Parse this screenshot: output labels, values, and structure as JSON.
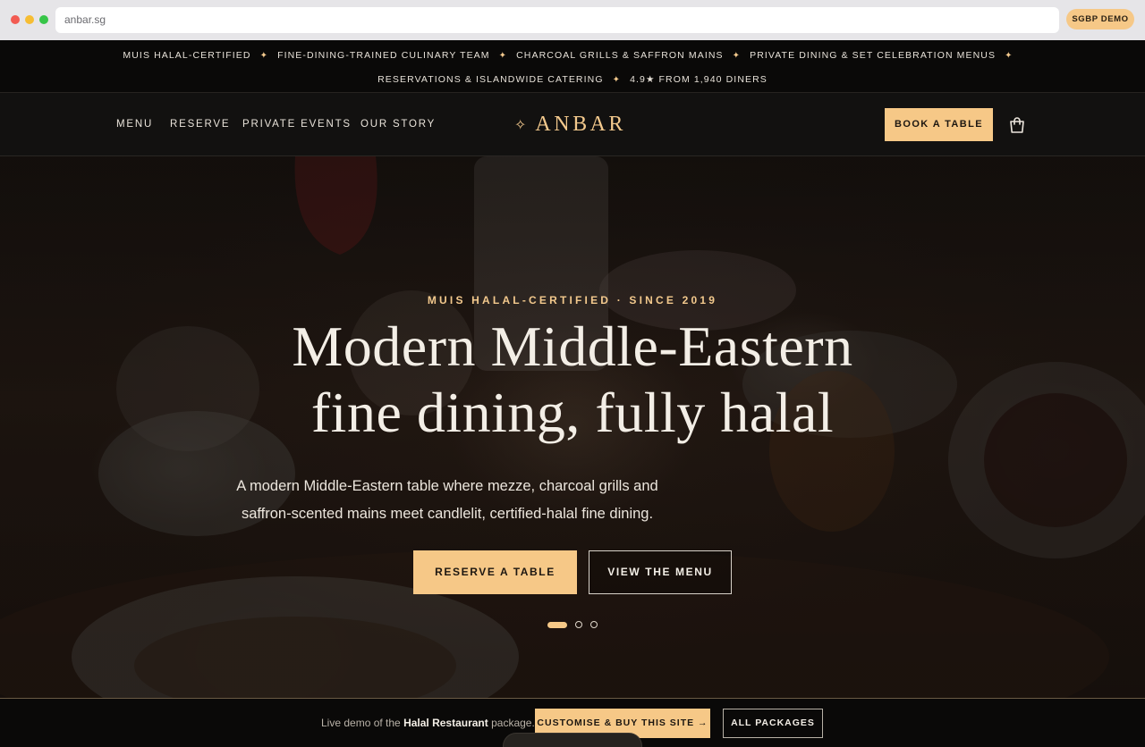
{
  "browser": {
    "url": "anbar.sg",
    "badge": "SGBP DEMO"
  },
  "trust_strip": {
    "row1": [
      "MUIS HALAL-CERTIFIED",
      "FINE-DINING-TRAINED CULINARY TEAM",
      "CHARCOAL GRILLS & SAFFRON MAINS",
      "PRIVATE DINING & SET CELEBRATION MENUS"
    ],
    "row2": [
      "RESERVATIONS & ISLANDWIDE CATERING",
      "4.9★ FROM 1,940 DINERS"
    ],
    "separator": "✦"
  },
  "nav": {
    "links": [
      "MENU",
      "RESERVE",
      "PRIVATE EVENTS",
      "OUR STORY"
    ],
    "logo_mark": "✧",
    "logo_text": "ANBAR",
    "cta": "BOOK A TABLE",
    "cart_icon": "shopping-bag-icon"
  },
  "hero": {
    "eyebrow": "MUIS HALAL-CERTIFIED · SINCE 2019",
    "title_line1": "Modern Middle-Eastern",
    "title_line2": "fine dining, fully halal",
    "subtitle": "A modern Middle-Eastern table where mezze, charcoal grills and saffron-scented mains meet candlelit, certified-halal fine dining.",
    "primary_cta": "RESERVE A TABLE",
    "secondary_cta": "VIEW THE MENU",
    "slides_total": 3,
    "slide_active": 1
  },
  "demo_bar": {
    "text_prefix": "Live demo of the ",
    "package_name": "Halal Restaurant",
    "text_suffix": " package.",
    "customise_cta": "CUSTOMISE & BUY THIS SITE →",
    "packages_cta": "ALL PACKAGES"
  },
  "colors": {
    "accent": "#f6c887",
    "background": "#0c0b0a",
    "nav_bg": "#121110",
    "text": "#e9e3da"
  }
}
